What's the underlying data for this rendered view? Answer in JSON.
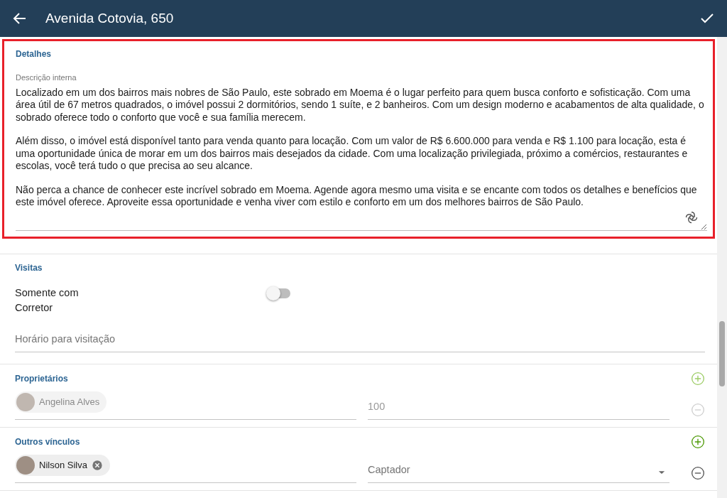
{
  "header": {
    "title": "Avenida Cotovia, 650"
  },
  "details": {
    "heading": "Detalhes",
    "highlighted": true,
    "field_label": "Descrição interna",
    "paragraphs": [
      "Localizado em um dos bairros mais nobres de São Paulo, este sobrado em Moema é o lugar perfeito para quem busca conforto e sofisticação. Com uma área útil de 67 metros quadrados, o imóvel possui 2 dormitórios, sendo 1 suíte, e 2 banheiros. Com um design moderno e acabamentos de alta qualidade, o sobrado oferece todo o conforto que você e sua família merecem.",
      "Além disso, o imóvel está disponível tanto para venda quanto para locação. Com um valor de R$ 6.600.000 para venda e R$ 1.100 para locação, esta é uma oportunidade única de morar em um dos bairros mais desejados da cidade. Com uma localização privilegiada, próximo a comércios, restaurantes e escolas, você terá tudo o que precisa ao seu alcance.",
      "Não perca a chance de conhecer este incrível sobrado em Moema. Agende agora mesmo uma visita e se encante com todos os detalhes e benefícios que este imóvel oferece. Aproveite essa oportunidade e venha viver com estilo e conforto em um dos melhores bairros de São Paulo."
    ]
  },
  "visits": {
    "heading": "Visitas",
    "toggle": {
      "label": "Somente com Corretor",
      "on": false
    },
    "schedule": {
      "placeholder": "Horário para visitação"
    }
  },
  "people_sections": [
    {
      "heading": "Proprietários",
      "disabled": true,
      "rows": [
        {
          "name": "Angelina Alves",
          "removable": false,
          "field": {
            "kind": "text",
            "value": "100"
          }
        }
      ]
    },
    {
      "heading": "Outros vínculos",
      "disabled": false,
      "rows": [
        {
          "name": "Nilson Silva",
          "removable": true,
          "field": {
            "kind": "select",
            "placeholder": "Captador"
          }
        }
      ]
    }
  ]
}
